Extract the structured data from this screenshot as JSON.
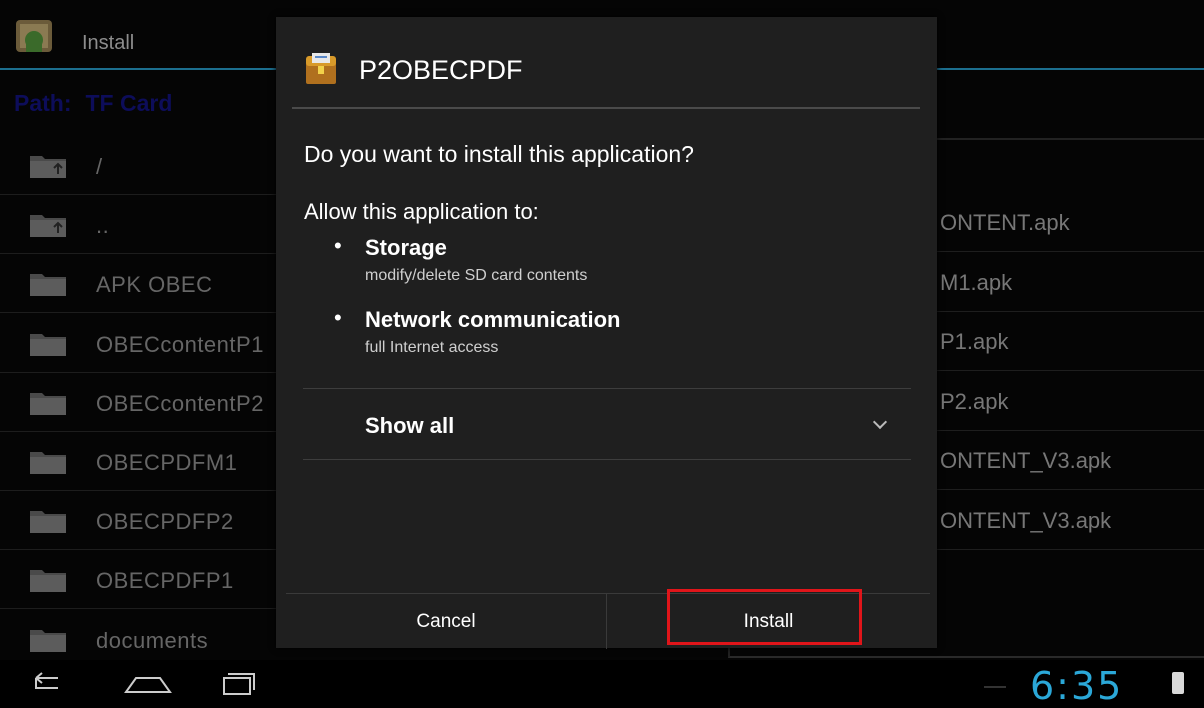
{
  "background_app": {
    "title": "Install",
    "path_label": "Path:",
    "path_value": "TF Card",
    "files": [
      {
        "name": "/",
        "icon": "folder-up-icon"
      },
      {
        "name": "..",
        "icon": "folder-up-icon"
      },
      {
        "name": "APK OBEC",
        "icon": "folder-icon"
      },
      {
        "name": "OBECcontentP1",
        "icon": "folder-icon"
      },
      {
        "name": "OBECcontentP2",
        "icon": "folder-icon"
      },
      {
        "name": "OBECPDFM1",
        "icon": "folder-icon"
      },
      {
        "name": "OBECPDFP2",
        "icon": "folder-icon"
      },
      {
        "name": "OBECPDFP1",
        "icon": "folder-icon"
      },
      {
        "name": "documents",
        "icon": "folder-icon"
      }
    ],
    "apk_list": [
      "ONTENT.apk",
      "M1.apk",
      "P1.apk",
      "P2.apk",
      "ONTENT_V3.apk",
      "ONTENT_V3.apk"
    ]
  },
  "dialog": {
    "title": "P2OBECPDF",
    "icon": "treasure-chest-app-icon",
    "question": "Do you want to install this application?",
    "allow_heading": "Allow this application to:",
    "permissions": [
      {
        "title": "Storage",
        "desc": "modify/delete SD card contents"
      },
      {
        "title": "Network communication",
        "desc": "full Internet access"
      }
    ],
    "show_all": "Show all",
    "cancel_label": "Cancel",
    "install_label": "Install"
  },
  "system_bar": {
    "time": "6:35"
  },
  "colors": {
    "accent": "#2ba8d8",
    "highlight": "#e0151a",
    "dialog_bg": "#1f1f1f"
  }
}
